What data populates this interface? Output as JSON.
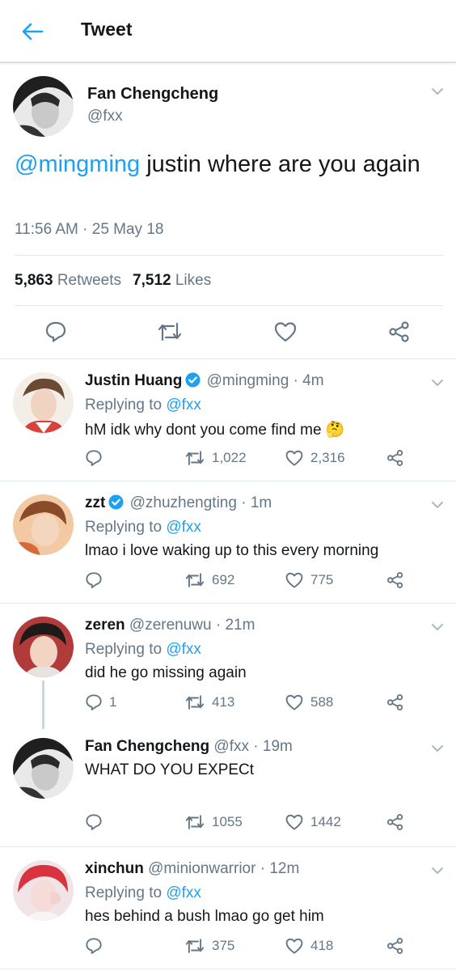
{
  "header": {
    "title": "Tweet"
  },
  "main_tweet": {
    "name": "Fan Chengcheng",
    "handle": "@fxx",
    "mention": "@mingming",
    "text": " justin where are you again",
    "time": "11:56 AM · 25 May 18",
    "retweets_count": "5,863",
    "retweets_label": "Retweets",
    "likes_count": "7,512",
    "likes_label": "Likes"
  },
  "replies": [
    {
      "name": "Justin Huang",
      "verified": true,
      "handle": "@mingming",
      "time": "· 4m",
      "replying_prefix": "Replying to ",
      "replying_to": "@fxx",
      "text": "hM idk why dont you come find me 🤔",
      "reply_count": "",
      "retweet_count": "1,022",
      "like_count": "2,316"
    },
    {
      "name": "zzt",
      "verified": true,
      "handle": "@zhuzhengting",
      "time": "· 1m",
      "replying_prefix": "Replying to ",
      "replying_to": "@fxx",
      "text": "lmao i love waking up to this every morning",
      "reply_count": "",
      "retweet_count": "692",
      "like_count": "775"
    },
    {
      "name": "zeren",
      "verified": false,
      "handle": "@zerenuwu",
      "time": "· 21m",
      "replying_prefix": "Replying to ",
      "replying_to": "@fxx",
      "text": "did he go missing again",
      "reply_count": "1",
      "retweet_count": "413",
      "like_count": "588"
    },
    {
      "name": "Fan Chengcheng",
      "verified": false,
      "handle": "@fxx",
      "time": "· 19m",
      "text": "WHAT DO YOU EXPECt",
      "reply_count": "",
      "retweet_count": "1055",
      "like_count": "1442"
    },
    {
      "name": "xinchun",
      "verified": false,
      "handle": "@minionwarrior",
      "time": "· 12m",
      "replying_prefix": "Replying to ",
      "replying_to": "@fxx",
      "text": "hes behind a bush lmao go get him",
      "reply_count": "",
      "retweet_count": "375",
      "like_count": "418"
    }
  ],
  "colors": {
    "accent": "#1da1f2",
    "secondary_text": "#657786",
    "divider": "#e1e8ed"
  },
  "icons": [
    "back-arrow-icon",
    "chevron-down-icon",
    "reply-icon",
    "retweet-icon",
    "heart-icon",
    "share-icon",
    "verified-badge-icon",
    "thinking-emoji"
  ]
}
